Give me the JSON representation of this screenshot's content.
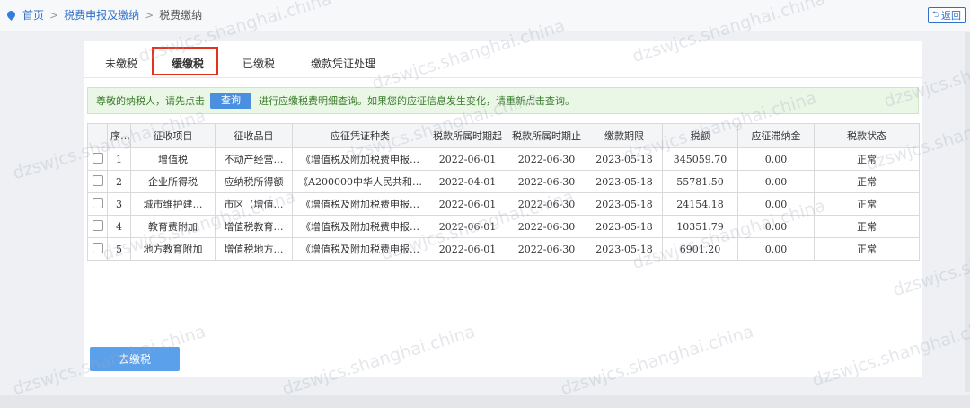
{
  "breadcrumb": {
    "home": "首页",
    "level1": "税费申报及缴纳",
    "current": "税费缴纳",
    "separator": ">"
  },
  "back_button": {
    "label": "返回",
    "icon": "return-arrow-icon"
  },
  "tabs": [
    {
      "label": "未缴税",
      "active": false
    },
    {
      "label": "缓缴税",
      "active": true
    },
    {
      "label": "已缴税",
      "active": false
    },
    {
      "label": "缴款凭证处理",
      "active": false
    }
  ],
  "notice": {
    "before": "尊敬的纳税人，请先点击",
    "button": "查询",
    "after": "进行应缴税费明细查询。如果您的应征信息发生变化，请重新点击查询。"
  },
  "table": {
    "headers": [
      "",
      "序号",
      "征收项目",
      "征收品目",
      "应征凭证种类",
      "税款所属时期起",
      "税款所属时期止",
      "缴款期限",
      "税额",
      "应征滞纳金",
      "税款状态"
    ],
    "rows": [
      [
        "1",
        "增值税",
        "不动产经营…",
        "《增值税及附加税费申报…",
        "2022-06-01",
        "2022-06-30",
        "2023-05-18",
        "345059.70",
        "0.00",
        "正常"
      ],
      [
        "2",
        "企业所得税",
        "应纳税所得额",
        "《A200000中华人民共和…",
        "2022-04-01",
        "2022-06-30",
        "2023-05-18",
        "55781.50",
        "0.00",
        "正常"
      ],
      [
        "3",
        "城市维护建…",
        "市区（增值…",
        "《增值税及附加税费申报…",
        "2022-06-01",
        "2022-06-30",
        "2023-05-18",
        "24154.18",
        "0.00",
        "正常"
      ],
      [
        "4",
        "教育费附加",
        "增值税教育…",
        "《增值税及附加税费申报…",
        "2022-06-01",
        "2022-06-30",
        "2023-05-18",
        "10351.79",
        "0.00",
        "正常"
      ],
      [
        "5",
        "地方教育附加",
        "增值税地方…",
        "《增值税及附加税费申报…",
        "2022-06-01",
        "2022-06-30",
        "2023-05-18",
        "6901.20",
        "0.00",
        "正常"
      ]
    ]
  },
  "pay_button": {
    "label": "去缴税"
  },
  "watermark": "dzswjcs.shanghai.china",
  "colors": {
    "link": "#2f6fc9",
    "notice_bg": "#eaf6e6",
    "notice_text": "#3a7d2c",
    "primary_button": "#5aa0ea",
    "highlight_box": "#e0341f"
  }
}
